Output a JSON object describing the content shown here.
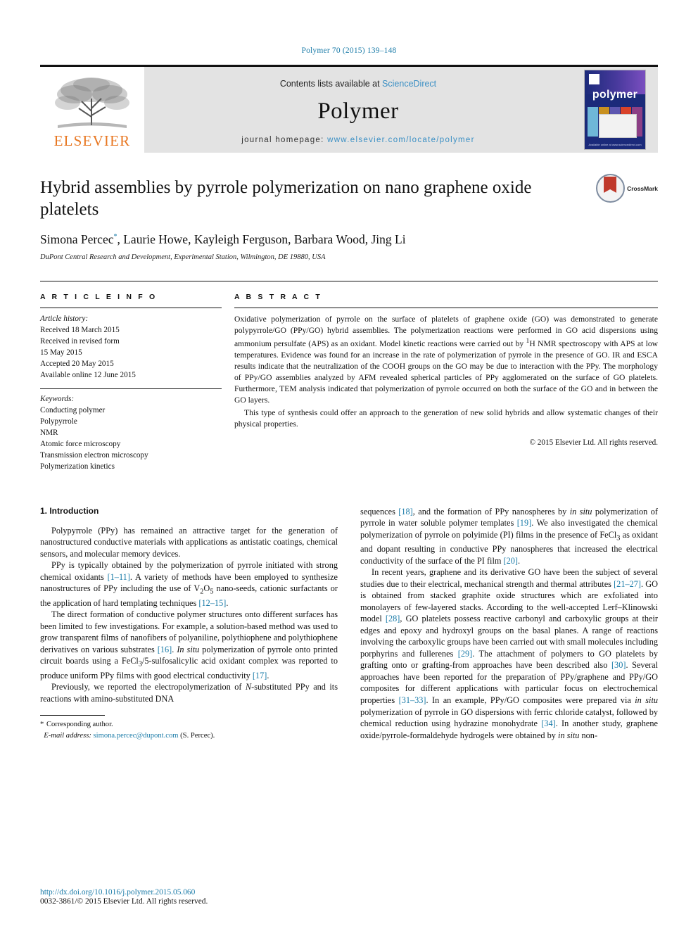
{
  "running_head": "Polymer 70 (2015) 139–148",
  "masthead": {
    "publisher_name": "ELSEVIER",
    "contents_prefix": "Contents lists available at ",
    "contents_link": "ScienceDirect",
    "journal_name": "Polymer",
    "homepage_label": "journal homepage: ",
    "homepage_url": "www.elsevier.com/locate/polymer",
    "cover_title": "polymer",
    "cover_footer": "Available online at www.sciencedirect.com"
  },
  "article": {
    "title": "Hybrid assemblies by pyrrole polymerization on nano graphene oxide platelets",
    "crossmark_label": "CrossMark",
    "authors": "Simona Percec",
    "authors_rest": ", Laurie Howe, Kayleigh Ferguson, Barbara Wood, Jing Li",
    "corresponding_marker": "*",
    "affiliation": "DuPont Central Research and Development, Experimental Station, Wilmington, DE 19880, USA"
  },
  "info": {
    "heading": "A R T I C L E   I N F O",
    "history_label": "Article history:",
    "history": [
      "Received 18 March 2015",
      "Received in revised form",
      "15 May 2015",
      "Accepted 20 May 2015",
      "Available online 12 June 2015"
    ],
    "keywords_label": "Keywords:",
    "keywords": [
      "Conducting polymer",
      "Polypyrrole",
      "NMR",
      "Atomic force microscopy",
      "Transmission electron microscopy",
      "Polymerization kinetics"
    ]
  },
  "abstract": {
    "heading": "A B S T R A C T",
    "paragraph1_a": "Oxidative polymerization of pyrrole on the surface of platelets of graphene oxide (GO) was demonstrated to generate polypyrrole/GO (PPy/GO) hybrid assemblies. The polymerization reactions were performed in GO acid dispersions using ammonium persulfate (APS) as an oxidant. Model kinetic reactions were carried out by ",
    "paragraph1_sup": "1",
    "paragraph1_b": "H NMR spectroscopy with APS at low temperatures. Evidence was found for an increase in the rate of polymerization of pyrrole in the presence of GO. IR and ESCA results indicate that the neutralization of the COOH groups on the GO may be due to interaction with the PPy. The morphology of PPy/GO assemblies analyzed by AFM revealed spherical particles of PPy agglomerated on the surface of GO platelets. Furthermore, TEM analysis indicated that polymerization of pyrrole occurred on both the surface of the GO and in between the GO layers.",
    "paragraph2": "This type of synthesis could offer an approach to the generation of new solid hybrids and allow systematic changes of their physical properties.",
    "copyright": "© 2015 Elsevier Ltd. All rights reserved."
  },
  "body": {
    "section_heading": "1. Introduction",
    "left": {
      "p1": "Polypyrrole (PPy) has remained an attractive target for the generation of nanostructured conductive materials with applications as antistatic coatings, chemical sensors, and molecular memory devices.",
      "p2_a": "PPy is typically obtained by the polymerization of pyrrole initiated with strong chemical oxidants ",
      "p2_ref1": "[1–11]",
      "p2_b": ". A variety of methods have been employed to synthesize nanostructures of PPy including the use of V",
      "p2_sub1": "2",
      "p2_c": "O",
      "p2_sub2": "5",
      "p2_d": " nano-seeds, cationic surfactants or the application of hard templating techniques ",
      "p2_ref2": "[12–15]",
      "p2_e": ".",
      "p3_a": "The direct formation of conductive polymer structures onto different surfaces has been limited to few investigations. For example, a solution-based method was used to grow transparent films of nanofibers of polyaniline, polythiophene and polythiophene derivatives on various substrates ",
      "p3_ref1": "[16]",
      "p3_b": ". ",
      "p3_it1": "In situ",
      "p3_c": " polymerization of pyrrole onto printed circuit boards using a FeCl",
      "p3_sub1": "3",
      "p3_d": "/5-sulfosalicylic acid oxidant complex was reported to produce uniform PPy films with good electrical conductivity ",
      "p3_ref2": "[17]",
      "p3_e": ".",
      "p4_a": "Previously, we reported the electropolymerization of ",
      "p4_it1": "N",
      "p4_b": "-substituted PPy and its reactions with amino-substituted DNA"
    },
    "right": {
      "p1_a": "sequences ",
      "p1_ref1": "[18]",
      "p1_b": ", and the formation of PPy nanospheres by ",
      "p1_it1": "in situ",
      "p1_c": " polymerization of pyrrole in water soluble polymer templates ",
      "p1_ref2": "[19]",
      "p1_d": ". We also investigated the chemical polymerization of pyrrole on polyimide (PI) films in the presence of FeCl",
      "p1_sub1": "3",
      "p1_e": " as oxidant and dopant resulting in conductive PPy nanospheres that increased the electrical conductivity of the surface of the PI film ",
      "p1_ref3": "[20]",
      "p1_f": ".",
      "p2_a": "In recent years, graphene and its derivative GO have been the subject of several studies due to their electrical, mechanical strength and thermal attributes ",
      "p2_ref1": "[21–27]",
      "p2_b": ". GO is obtained from stacked graphite oxide structures which are exfoliated into monolayers of few-layered stacks. According to the well-accepted Lerf–Klinowski model ",
      "p2_ref2": "[28]",
      "p2_c": ", GO platelets possess reactive carbonyl and carboxylic groups at their edges and epoxy and hydroxyl groups on the basal planes. A range of reactions involving the carboxylic groups have been carried out with small molecules including porphyrins and fullerenes ",
      "p2_ref3": "[29]",
      "p2_d": ". The attachment of polymers to GO platelets by grafting onto or grafting-from approaches have been described also ",
      "p2_ref4": "[30]",
      "p2_e": ". Several approaches have been reported for the preparation of PPy/graphene and PPy/GO composites for different applications with particular focus on electrochemical properties ",
      "p2_ref5": "[31–33]",
      "p2_f": ". In an example, PPy/GO composites were prepared via ",
      "p2_it1": "in situ",
      "p2_g": " polymerization of pyrrole in GO dispersions with ferric chloride catalyst, followed by chemical reduction using hydrazine monohydrate ",
      "p2_ref6": "[34]",
      "p2_h": ". In another study, graphene oxide/pyrrole-formaldehyde hydrogels were obtained by ",
      "p2_it2": "in situ",
      "p2_i": " non-"
    }
  },
  "footer": {
    "corresponding_star": "*",
    "corresponding_label": " Corresponding author.",
    "email_label": "E-mail address:",
    "email": "simona.percec@dupont.com",
    "email_suffix": " (S. Percec).",
    "doi": "http://dx.doi.org/10.1016/j.polymer.2015.05.060",
    "issn": "0032-3861/© 2015 Elsevier Ltd. All rights reserved."
  },
  "colors": {
    "link": "#1a7ba8",
    "elsevier_orange": "#e87722",
    "cover_blue": "#1b2a7a"
  }
}
